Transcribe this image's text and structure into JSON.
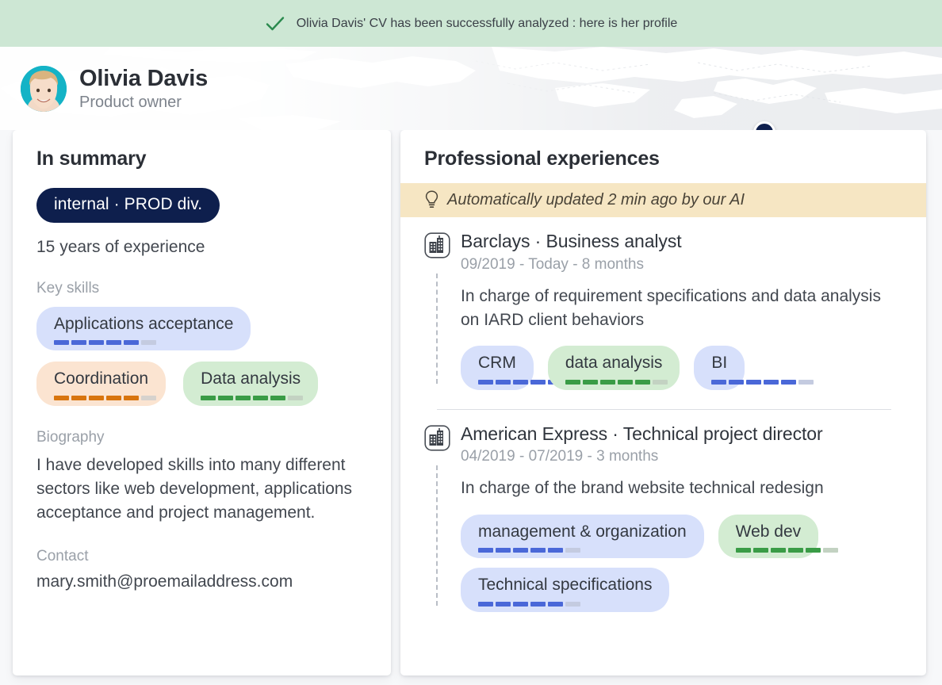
{
  "banner": {
    "icon": "check-icon",
    "message": "Olivia Davis' CV has been successfully analyzed : here is her profile",
    "background_color": "#cde7d4",
    "text_color": "#2a8a4e"
  },
  "header": {
    "avatar_alt": "Olivia Davis photo",
    "name": "Olivia Davis",
    "role": "Product owner",
    "map_pin": {
      "name": "location-pin",
      "color": "#0e1f4d"
    }
  },
  "summary": {
    "title": "In summary",
    "badge": "internal · PROD div.",
    "badge_color": "#0e1f4d",
    "experience": "15 years of experience",
    "key_skills_label": "Key skills",
    "key_skills": [
      {
        "label": "Applications acceptance",
        "color": "blue",
        "level": 5,
        "max": 6
      },
      {
        "label": "Coordination",
        "color": "orange",
        "level": 5,
        "max": 6
      },
      {
        "label": "Data analysis",
        "color": "green",
        "level": 5,
        "max": 6
      }
    ],
    "biography_label": "Biography",
    "biography": "I have developed skills into many different sectors like web development, applications acceptance and project management.",
    "contact_label": "Contact",
    "contact": "mary.smith@proemailaddress.com"
  },
  "experiences_panel": {
    "title": "Professional experiences",
    "notice": {
      "icon": "lightbulb-icon",
      "text": "Automatically updated 2 min ago by our AI",
      "background_color": "#f6e6c3"
    },
    "items": [
      {
        "icon": "building-icon",
        "title": "Barclays · Business analyst",
        "dates": "09/2019 - Today - 8 months",
        "description": "In charge of requirement specifications and data analysis on IARD client behaviors",
        "tags": [
          {
            "label": "CRM",
            "color": "blue",
            "level": 5,
            "max": 6
          },
          {
            "label": "data analysis",
            "color": "green",
            "level": 5,
            "max": 6
          },
          {
            "label": "BI",
            "color": "blue",
            "level": 5,
            "max": 6
          }
        ]
      },
      {
        "icon": "building-icon",
        "title": "American Express · Technical project director",
        "dates": "04/2019 - 07/2019 - 3 months",
        "description": "In charge of the brand website technical redesign",
        "tags": [
          {
            "label": "management & organization",
            "color": "blue",
            "level": 5,
            "max": 6
          },
          {
            "label": "Web dev",
            "color": "green",
            "level": 5,
            "max": 6
          },
          {
            "label": "Technical specifications",
            "color": "blue",
            "level": 5,
            "max": 6
          }
        ]
      }
    ]
  }
}
